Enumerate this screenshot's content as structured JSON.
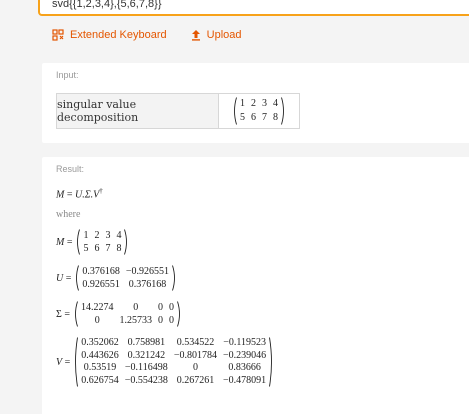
{
  "query": {
    "value": "svd{{1,2,3,4},{5,6,7,8}}"
  },
  "toolbar": {
    "keyboard_label": "Extended Keyboard",
    "upload_label": "Upload"
  },
  "input_pod": {
    "title": "Input:",
    "interpretation": "singular value decomposition",
    "matrix": [
      [
        "1",
        "2",
        "3",
        "4"
      ],
      [
        "5",
        "6",
        "7",
        "8"
      ]
    ]
  },
  "result_pod": {
    "title": "Result:",
    "decomposition": {
      "lhs": "M",
      "eq": " = ",
      "rhs": "U.Σ.V",
      "sup": "†"
    },
    "where_text": "where",
    "M": {
      "lhs": "M",
      "rows": [
        [
          "1",
          "2",
          "3",
          "4"
        ],
        [
          "5",
          "6",
          "7",
          "8"
        ]
      ]
    },
    "U": {
      "lhs": "U",
      "rows": [
        [
          "0.376168",
          "−0.926551"
        ],
        [
          "0.926551",
          "0.376168"
        ]
      ]
    },
    "Sigma": {
      "lhs": "Σ",
      "rows": [
        [
          "14.2274",
          "0",
          "0",
          "0"
        ],
        [
          "0",
          "1.25733",
          "0",
          "0"
        ]
      ]
    },
    "V": {
      "lhs": "V",
      "rows": [
        [
          "0.352062",
          "0.758981",
          "0.534522",
          "−0.119523"
        ],
        [
          "0.443626",
          "0.321242",
          "−0.801784",
          "−0.239046"
        ],
        [
          "0.53519",
          "−0.116498",
          "0",
          "0.83666"
        ],
        [
          "0.626754",
          "−0.554238",
          "0.267261",
          "−0.478091"
        ]
      ]
    }
  },
  "colors": {
    "accent": "#e45600",
    "input_border": "#f7a21a",
    "background": "#f4f4f4"
  },
  "icons": {
    "keyboard": "keyboard-icon",
    "upload": "upload-icon"
  }
}
